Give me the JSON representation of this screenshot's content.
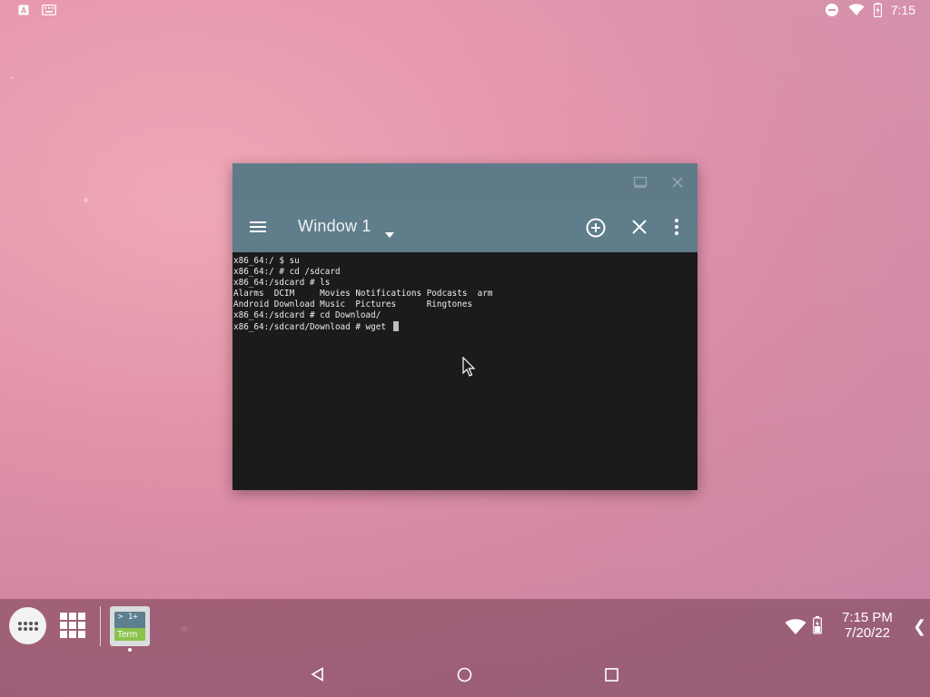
{
  "status_bar": {
    "time": "7:15",
    "left_icons": [
      "keyboard-a-icon",
      "keyboard-icon"
    ],
    "right_icons": [
      "do-not-disturb-icon",
      "wifi-icon",
      "battery-charging-icon"
    ]
  },
  "window": {
    "title": "Window 1",
    "caption_buttons": [
      "maximize-icon",
      "close-icon"
    ],
    "app_bar_icons": [
      "menu-icon",
      "dropdown-icon",
      "add-circle-icon",
      "close-icon",
      "overflow-icon"
    ],
    "terminal_lines": [
      "x86_64:/ $ su",
      "x86_64:/ # cd /sdcard",
      "x86_64:/sdcard # ls",
      "Alarms  DCIM     Movies Notifications Podcasts  arm",
      "Android Download Music  Pictures      Ringtones",
      "x86_64:/sdcard # cd Download/",
      "x86_64:/sdcard/Download # wget "
    ]
  },
  "taskbar": {
    "app_icon": {
      "top_label": "> 1+",
      "bottom_label": "Term"
    },
    "clock_time": "7:15 PM",
    "clock_date": "7/20/22",
    "expand_glyph": "❮"
  },
  "colors": {
    "caption": "#5f7b89",
    "app_bar": "#607d8b",
    "terminal_bg": "#1b1b1b",
    "terminal_fg": "#ececec"
  }
}
